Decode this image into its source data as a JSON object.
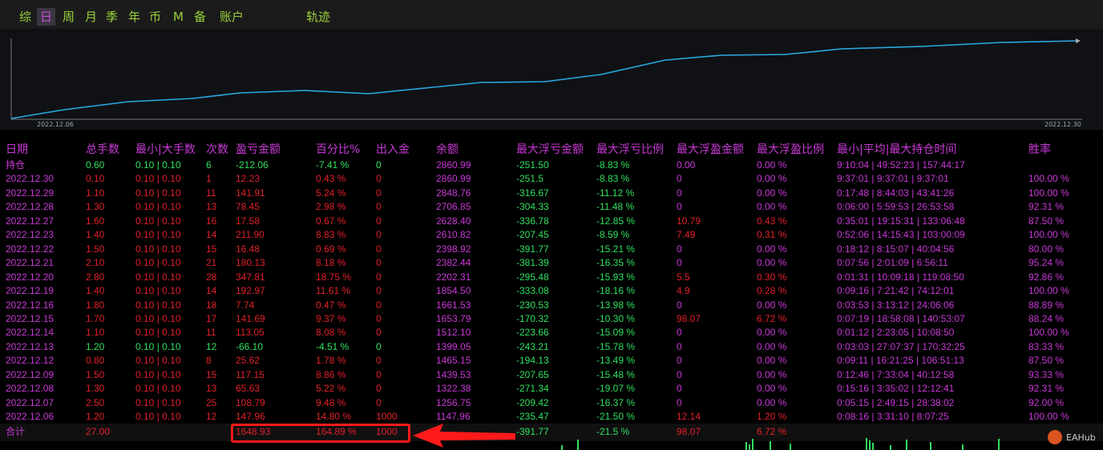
{
  "tabs": [
    "综",
    "日",
    "周",
    "月",
    "季",
    "年",
    "币",
    "M",
    "备",
    "账户",
    "轨迹"
  ],
  "active_tab": "日",
  "chart": {
    "start_date": "2022.12.06",
    "end_date": "2022.12.30",
    "line_color": "#29a9e1"
  },
  "headers": [
    "日期",
    "总手数",
    "最小|大手数",
    "次数",
    "盈亏金额",
    "百分比%",
    "出入金",
    "余额",
    "最大浮亏金额",
    "最大浮亏比例",
    "最大浮盈金额",
    "最大浮盈比例",
    "最小|平均|最大持仓时间",
    "胜率"
  ],
  "rows": [
    {
      "date": "持仓",
      "lots": "0.60",
      "minmax": "0.10 | 0.10",
      "count": "6",
      "pnl": "-212.06",
      "pct": "-7.41 %",
      "flow": "0",
      "balance": "2860.99",
      "maxloss": "-251.50",
      "maxlosspct": "-8.83 %",
      "maxgain": "0.00",
      "maxgainpct": "0.00 %",
      "time": "9:10:04 | 49:52:23 | 157:44:17",
      "win": ""
    },
    {
      "date": "2022.12.30",
      "lots": "0.10",
      "minmax": "0.10 | 0.10",
      "count": "1",
      "pnl": "12.23",
      "pct": "0.43 %",
      "flow": "0",
      "balance": "2860.99",
      "maxloss": "-251.5",
      "maxlosspct": "-8.83 %",
      "maxgain": "0",
      "maxgainpct": "0.00 %",
      "time": "9:37:01 | 9:37:01 | 9:37:01",
      "win": "100.00 %"
    },
    {
      "date": "2022.12.29",
      "lots": "1.10",
      "minmax": "0.10 | 0.10",
      "count": "11",
      "pnl": "141.91",
      "pct": "5.24 %",
      "flow": "0",
      "balance": "2848.76",
      "maxloss": "-316.67",
      "maxlosspct": "-11.12 %",
      "maxgain": "0",
      "maxgainpct": "0.00 %",
      "time": "0:17:48 | 8:44:03 | 43:41:26",
      "win": "100.00 %"
    },
    {
      "date": "2022.12.28",
      "lots": "1.30",
      "minmax": "0.10 | 0.10",
      "count": "13",
      "pnl": "78.45",
      "pct": "2.98 %",
      "flow": "0",
      "balance": "2706.85",
      "maxloss": "-304.33",
      "maxlosspct": "-11.48 %",
      "maxgain": "0",
      "maxgainpct": "0.00 %",
      "time": "0:06:00 | 5:59:53 | 26:53:58",
      "win": "92.31 %"
    },
    {
      "date": "2022.12.27",
      "lots": "1.60",
      "minmax": "0.10 | 0.10",
      "count": "16",
      "pnl": "17.58",
      "pct": "0.67 %",
      "flow": "0",
      "balance": "2628.40",
      "maxloss": "-336.78",
      "maxlosspct": "-12.85 %",
      "maxgain": "10.79",
      "maxgainpct": "0.43 %",
      "time": "0:35:01 | 19:15:31 | 133:06:48",
      "win": "87.50 %"
    },
    {
      "date": "2022.12.23",
      "lots": "1.40",
      "minmax": "0.10 | 0.10",
      "count": "14",
      "pnl": "211.90",
      "pct": "8.83 %",
      "flow": "0",
      "balance": "2610.82",
      "maxloss": "-207.45",
      "maxlosspct": "-8.59 %",
      "maxgain": "7.49",
      "maxgainpct": "0.31 %",
      "time": "0:52:06 | 14:15:43 | 103:00:09",
      "win": "100.00 %"
    },
    {
      "date": "2022.12.22",
      "lots": "1.50",
      "minmax": "0.10 | 0.10",
      "count": "15",
      "pnl": "16.48",
      "pct": "0.69 %",
      "flow": "0",
      "balance": "2398.92",
      "maxloss": "-391.77",
      "maxlosspct": "-15.21 %",
      "maxgain": "0",
      "maxgainpct": "0.00 %",
      "time": "0:18:12 | 8:15:07 | 40:04:56",
      "win": "80.00 %"
    },
    {
      "date": "2022.12.21",
      "lots": "2.10",
      "minmax": "0.10 | 0.10",
      "count": "21",
      "pnl": "180.13",
      "pct": "8.18 %",
      "flow": "0",
      "balance": "2382.44",
      "maxloss": "-381.39",
      "maxlosspct": "-16.35 %",
      "maxgain": "0",
      "maxgainpct": "0.00 %",
      "time": "0:07:56 | 2:01:09 | 6:56:11",
      "win": "95.24 %"
    },
    {
      "date": "2022.12.20",
      "lots": "2.80",
      "minmax": "0.10 | 0.10",
      "count": "28",
      "pnl": "347.81",
      "pct": "18.75 %",
      "flow": "0",
      "balance": "2202.31",
      "maxloss": "-295.48",
      "maxlosspct": "-15.93 %",
      "maxgain": "5.5",
      "maxgainpct": "0.30 %",
      "time": "0:01:31 | 10:09:18 | 119:08:50",
      "win": "92.86 %"
    },
    {
      "date": "2022.12.19",
      "lots": "1.40",
      "minmax": "0.10 | 0.10",
      "count": "14",
      "pnl": "192.97",
      "pct": "11.61 %",
      "flow": "0",
      "balance": "1854.50",
      "maxloss": "-333.08",
      "maxlosspct": "-18.16 %",
      "maxgain": "4.9",
      "maxgainpct": "0.28 %",
      "time": "0:09:16 | 7:21:42 | 74:12:01",
      "win": "100.00 %"
    },
    {
      "date": "2022.12.16",
      "lots": "1.80",
      "minmax": "0.10 | 0.10",
      "count": "18",
      "pnl": "7.74",
      "pct": "0.47 %",
      "flow": "0",
      "balance": "1661.53",
      "maxloss": "-230.53",
      "maxlosspct": "-13.98 %",
      "maxgain": "0",
      "maxgainpct": "0.00 %",
      "time": "0:03:53 | 3:13:12 | 24:06:06",
      "win": "88.89 %"
    },
    {
      "date": "2022.12.15",
      "lots": "1.70",
      "minmax": "0.10 | 0.10",
      "count": "17",
      "pnl": "141.69",
      "pct": "9.37 %",
      "flow": "0",
      "balance": "1653.79",
      "maxloss": "-170.32",
      "maxlosspct": "-10.30 %",
      "maxgain": "98.07",
      "maxgainpct": "6.72 %",
      "time": "0:07:19 | 18:58:08 | 140:53:07",
      "win": "88.24 %"
    },
    {
      "date": "2022.12.14",
      "lots": "1.10",
      "minmax": "0.10 | 0.10",
      "count": "11",
      "pnl": "113.05",
      "pct": "8.08 %",
      "flow": "0",
      "balance": "1512.10",
      "maxloss": "-223.66",
      "maxlosspct": "-15.09 %",
      "maxgain": "0",
      "maxgainpct": "0.00 %",
      "time": "0:01:12 | 2:23:05 | 10:08:50",
      "win": "100.00 %"
    },
    {
      "date": "2022.12.13",
      "lots": "1.20",
      "minmax": "0.10 | 0.10",
      "count": "12",
      "pnl": "-66.10",
      "pct": "-4.51 %",
      "flow": "0",
      "balance": "1399.05",
      "maxloss": "-243.21",
      "maxlosspct": "-15.78 %",
      "maxgain": "0",
      "maxgainpct": "0.00 %",
      "time": "0:03:03 | 27:07:37 | 170:32:25",
      "win": "83.33 %"
    },
    {
      "date": "2022.12.12",
      "lots": "0.80",
      "minmax": "0.10 | 0.10",
      "count": "8",
      "pnl": "25.62",
      "pct": "1.78 %",
      "flow": "0",
      "balance": "1465.15",
      "maxloss": "-194.13",
      "maxlosspct": "-13.49 %",
      "maxgain": "0",
      "maxgainpct": "0.00 %",
      "time": "0:09:11 | 16:21:25 | 106:51:13",
      "win": "87.50 %"
    },
    {
      "date": "2022.12.09",
      "lots": "1.50",
      "minmax": "0.10 | 0.10",
      "count": "15",
      "pnl": "117.15",
      "pct": "8.86 %",
      "flow": "0",
      "balance": "1439.53",
      "maxloss": "-207.65",
      "maxlosspct": "-15.48 %",
      "maxgain": "0",
      "maxgainpct": "0.00 %",
      "time": "0:12:46 | 7:33:04 | 40:12:58",
      "win": "93.33 %"
    },
    {
      "date": "2022.12.08",
      "lots": "1.30",
      "minmax": "0.10 | 0.10",
      "count": "13",
      "pnl": "65.63",
      "pct": "5.22 %",
      "flow": "0",
      "balance": "1322.38",
      "maxloss": "-271.34",
      "maxlosspct": "-19.07 %",
      "maxgain": "0",
      "maxgainpct": "0.00 %",
      "time": "0:15:16 | 3:35:02 | 12:12:41",
      "win": "92.31 %"
    },
    {
      "date": "2022.12.07",
      "lots": "2.50",
      "minmax": "0.10 | 0.10",
      "count": "25",
      "pnl": "108.79",
      "pct": "9.48 %",
      "flow": "0",
      "balance": "1256.75",
      "maxloss": "-209.42",
      "maxlosspct": "-16.37 %",
      "maxgain": "0",
      "maxgainpct": "0.00 %",
      "time": "0:05:15 | 2:49:15 | 28:38:02",
      "win": "92.00 %"
    },
    {
      "date": "2022.12.06",
      "lots": "1.20",
      "minmax": "0.10 | 0.10",
      "count": "12",
      "pnl": "147.96",
      "pct": "14.80 %",
      "flow": "1000",
      "balance": "1147.96",
      "maxloss": "-235.47",
      "maxlosspct": "-21.50 %",
      "maxgain": "12.14",
      "maxgainpct": "1.20 %",
      "time": "0:08:16 | 3:31:10 | 8:07:25",
      "win": "100.00 %"
    }
  ],
  "total": {
    "label": "合计",
    "lots": "27.00",
    "pnl": "1648.93",
    "pct": "164.89 %",
    "flow": "1000",
    "maxloss": "-391.77",
    "maxlosspct": "-21.5 %",
    "maxgain": "98.07",
    "maxgainpct": "6.72 %"
  },
  "watermark": "EAHub"
}
